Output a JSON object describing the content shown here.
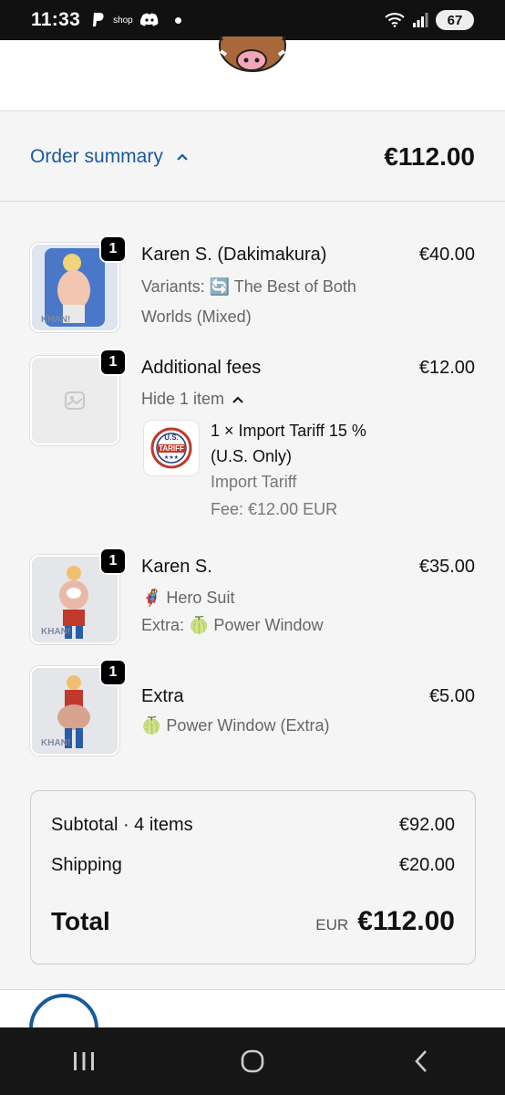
{
  "status_bar": {
    "time": "11:33",
    "shop_label": "shop",
    "battery": "67"
  },
  "summary": {
    "label": "Order summary",
    "total": "€112.00"
  },
  "items": [
    {
      "qty": "1",
      "title": "Karen S. (Dakimakura)",
      "price": "€40.00",
      "variants_line1": "Variants: 🔄 The Best of Both",
      "variants_line2": "Worlds (Mixed)",
      "thumb_label": "KHAN!"
    },
    {
      "qty": "1",
      "title": "Additional fees",
      "price": "€12.00",
      "toggle": "Hide 1 item",
      "sub_item": {
        "line1": "1 × Import Tariff 15 %",
        "line2": "(U.S. Only)",
        "line3": "Import Tariff",
        "line4": "Fee: €12.00 EUR",
        "badge_top": "U.S.",
        "badge_mid": "TARIFF",
        "badge_bottom": "★★★"
      }
    },
    {
      "qty": "1",
      "title": "Karen S.",
      "price": "€35.00",
      "line1": "🦸‍♀️ Hero Suit",
      "line2": "Extra: 🍈 Power Window",
      "thumb_label": "KHAN!"
    },
    {
      "qty": "1",
      "title": "Extra",
      "price": "€5.00",
      "line1": "🍈 Power Window (Extra)",
      "thumb_label": "KHAN!"
    }
  ],
  "totals": {
    "subtotal_label": "Subtotal · 4 items",
    "subtotal_value": "€92.00",
    "shipping_label": "Shipping",
    "shipping_value": "€20.00",
    "total_label": "Total",
    "currency": "EUR",
    "total_value": "€112.00"
  },
  "colors": {
    "link": "#1a5a9c",
    "background": "#f5f5f5"
  }
}
